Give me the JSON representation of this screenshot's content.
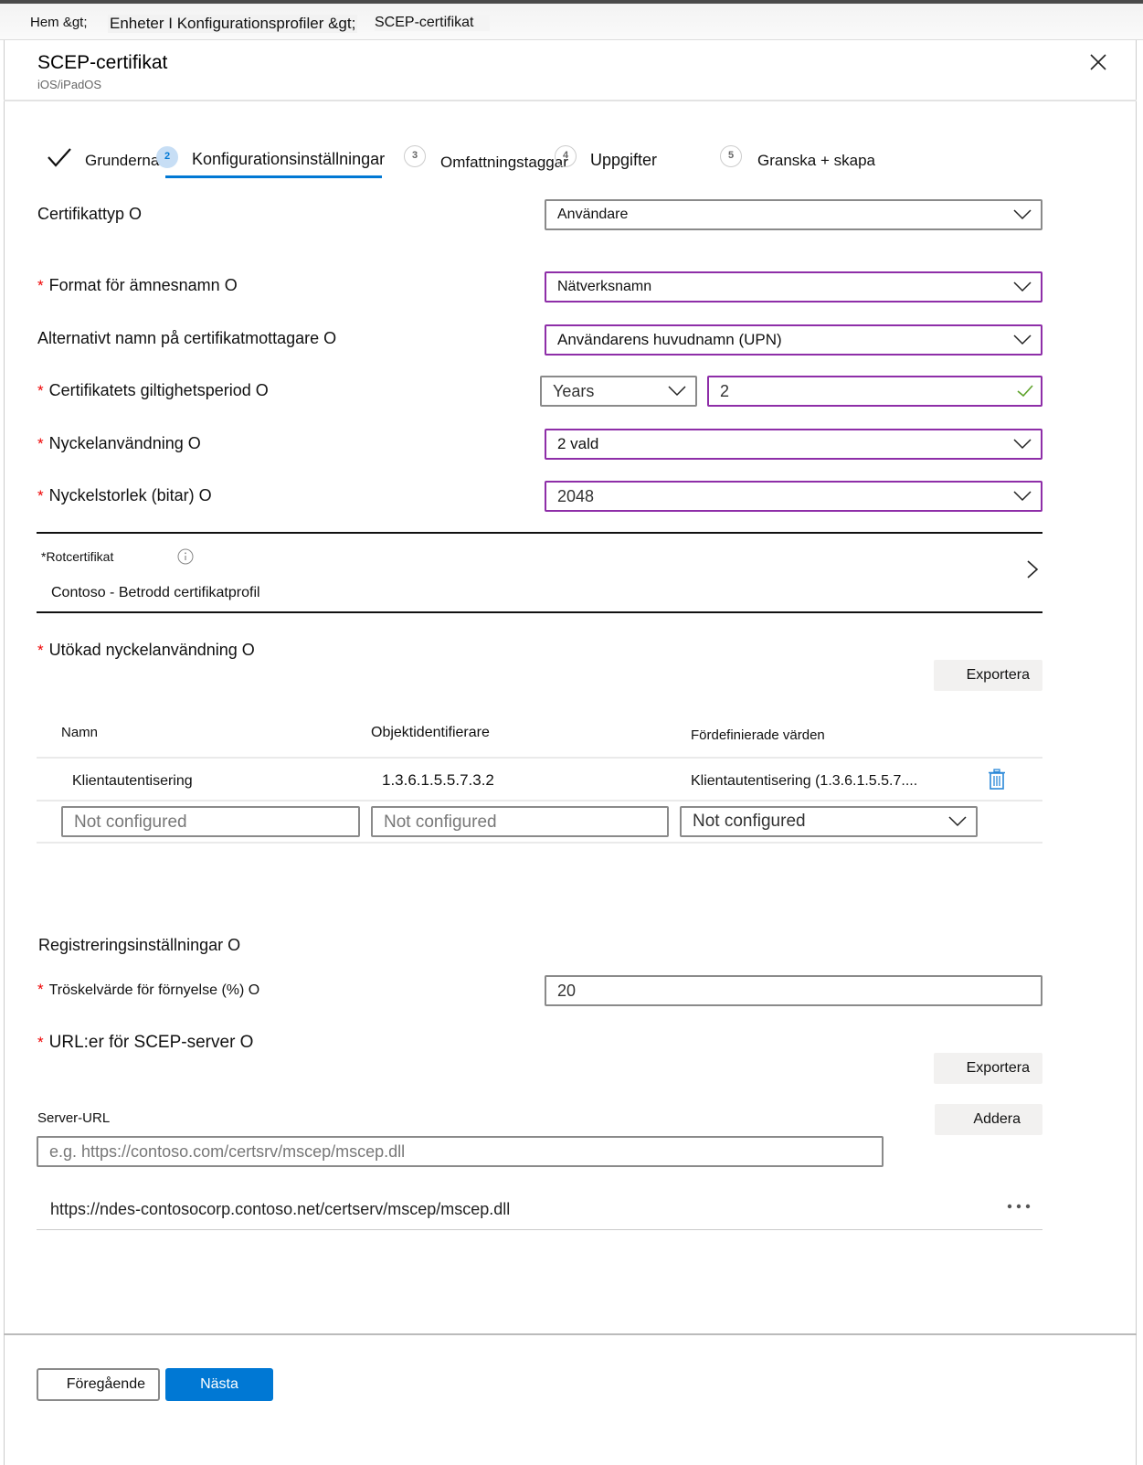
{
  "breadcrumb": {
    "items": [
      "Hem &gt;",
      "Enheter I Konfigurationsprofiler &gt;",
      "SCEP-certifikat"
    ]
  },
  "header": {
    "title": "SCEP-certifikat",
    "subtitle": "iOS/iPadOS",
    "close_icon": "close-icon"
  },
  "wizard": {
    "steps": [
      {
        "number": "",
        "label": "Grunderna",
        "state": "completed"
      },
      {
        "number": "2",
        "label": "Konfigurationsinställningar",
        "state": "active"
      },
      {
        "number": "3",
        "label": "Omfattningstaggar",
        "state": "pending"
      },
      {
        "number": "4",
        "label": "Uppgifter",
        "state": "pending"
      },
      {
        "number": "5",
        "label": "Granska + skapa",
        "state": "pending"
      }
    ]
  },
  "form": {
    "certificate_type": {
      "label": "Certifikattyp O",
      "required": false,
      "value": "Användare"
    },
    "subject_name_format": {
      "label": "Format för ämnesnamn O",
      "required": true,
      "value": "Nätverksnamn"
    },
    "subject_alt_name": {
      "label": "Alternativt namn på certifikatmottagare O",
      "required": false,
      "value": "Användarens huvudnamn (UPN)"
    },
    "validity_period": {
      "label": "Certifikatets giltighetsperiod O",
      "required": true,
      "unit": "Years",
      "value": "2"
    },
    "key_usage": {
      "label": "Nyckelanvändning O",
      "required": true,
      "value": "2 vald"
    },
    "key_size": {
      "label": "Nyckelstorlek (bitar) O",
      "required": true,
      "value": "2048"
    },
    "root_certificate": {
      "label": "*Rotcertifikat",
      "value": "Contoso - Betrodd certifikatprofil"
    },
    "extended_key_usage": {
      "label": "Utökad nyckelanvändning O",
      "required": true,
      "export_label": "Exportera",
      "columns": [
        "Namn",
        "Objektidentifierare",
        "Fördefinierade värden"
      ],
      "rows": [
        {
          "name": "Klientautentisering",
          "oid": "1.3.6.1.5.5.7.3.2",
          "predefined": "Klientautentisering (1.3.6.1.5.5.7...."
        }
      ],
      "new_row": {
        "name_placeholder": "Not configured",
        "oid_placeholder": "Not configured",
        "predefined_value": "Not configured"
      }
    },
    "enrollment_settings": {
      "label": "Registreringsinställningar O"
    },
    "renewal_threshold": {
      "label": "Tröskelvärde för förnyelse (%) O",
      "required": true,
      "value": "20"
    },
    "scep_urls": {
      "label": "URL:er för SCEP-server O",
      "required": true,
      "export_label": "Exportera",
      "add_label": "Addera",
      "field_label": "Server-URL",
      "placeholder": "e.g. https://contoso.com/certsrv/mscep/mscep.dll",
      "items": [
        "https://ndes-contosocorp.contoso.net/certserv/mscep/mscep.dll"
      ]
    }
  },
  "footer": {
    "previous_label": "Föregående",
    "next_label": "Nästa"
  },
  "colors": {
    "accent": "#0078d4",
    "required": "#e00000",
    "focus_border": "#8e2ea8",
    "valid": "#5ea32b"
  }
}
